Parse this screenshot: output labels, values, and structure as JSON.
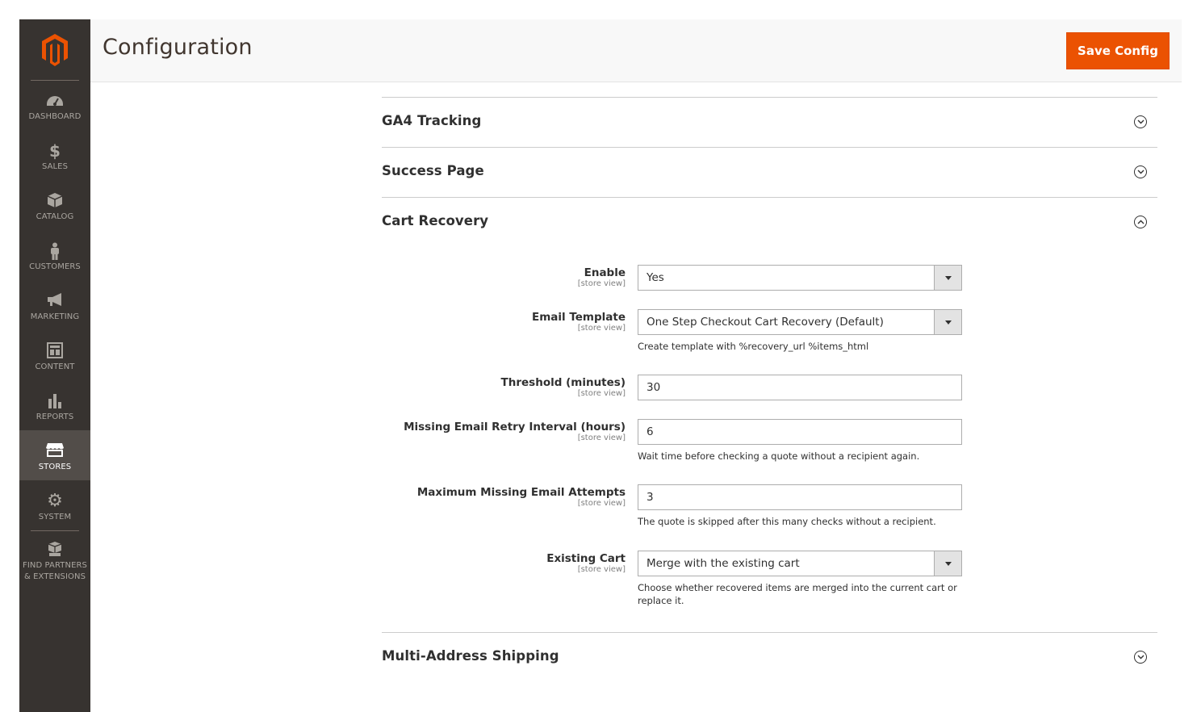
{
  "app": {
    "page_title": "Configuration",
    "save_label": "Save Config"
  },
  "colors": {
    "accent": "#eb5202",
    "sidebar": "#373330",
    "sidebar_active": "#524d49"
  },
  "nav": [
    {
      "label": "DASHBOARD",
      "icon": "dashboard-icon"
    },
    {
      "label": "SALES",
      "icon": "dollar-icon"
    },
    {
      "label": "CATALOG",
      "icon": "box-icon"
    },
    {
      "label": "CUSTOMERS",
      "icon": "person-icon"
    },
    {
      "label": "MARKETING",
      "icon": "megaphone-icon"
    },
    {
      "label": "CONTENT",
      "icon": "layout-icon"
    },
    {
      "label": "REPORTS",
      "icon": "bar-chart-icon"
    },
    {
      "label": "STORES",
      "icon": "store-icon",
      "active": true
    },
    {
      "label": "SYSTEM",
      "icon": "gear-icon"
    },
    {
      "label": "FIND PARTNERS",
      "label2": "& EXTENSIONS",
      "icon": "cubes-icon"
    }
  ],
  "sections": {
    "ga4": {
      "title": "GA4 Tracking",
      "expanded": false
    },
    "success": {
      "title": "Success Page",
      "expanded": false
    },
    "cart": {
      "title": "Cart Recovery",
      "expanded": true
    },
    "multi": {
      "title": "Multi-Address Shipping",
      "expanded": false
    }
  },
  "scope_label": "[store view]",
  "fields": {
    "enable": {
      "label": "Enable",
      "value": "Yes"
    },
    "email_template": {
      "label": "Email Template",
      "value": "One Step Checkout Cart Recovery (Default)",
      "note": "Create template with %recovery_url %items_html"
    },
    "threshold": {
      "label": "Threshold (minutes)",
      "value": "30"
    },
    "retry": {
      "label": "Missing Email Retry Interval (hours)",
      "value": "6",
      "note": "Wait time before checking a quote without a recipient again."
    },
    "max_attempts": {
      "label": "Maximum Missing Email Attempts",
      "value": "3",
      "note": "The quote is skipped after this many checks without a recipient."
    },
    "existing_cart": {
      "label": "Existing Cart",
      "value": "Merge with the existing cart",
      "note": "Choose whether recovered items are merged into the current cart or replace it."
    }
  }
}
